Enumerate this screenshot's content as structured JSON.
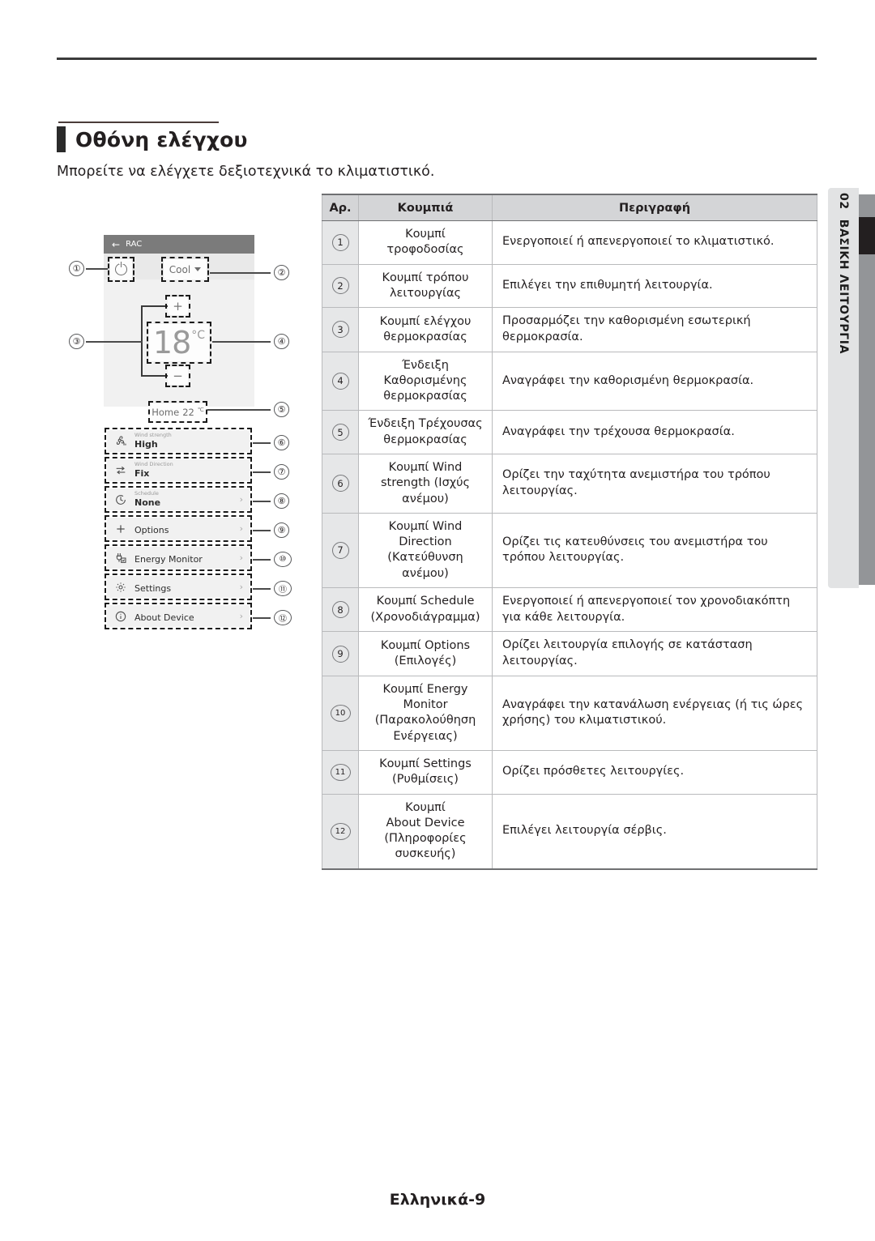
{
  "heading": {
    "title": "Οθόνη ελέγχου",
    "subtitle": "Μπορείτε να ελέγχετε δεξιοτεχνικά το κλιματιστικό."
  },
  "chapter_tab": {
    "number": "02",
    "label": "ΒΑΣΙΚΗ ΛΕΙΤΟΥΡΓΙΑ"
  },
  "device_mock": {
    "titlebar": {
      "back_icon": "←",
      "title": "RAC"
    },
    "power_button": "power-icon",
    "mode_button": {
      "label": "Cool",
      "caret": "▼"
    },
    "plus_button": "+",
    "minus_button": "−",
    "set_temp": {
      "value": "18",
      "unit": "°C"
    },
    "current_temp": {
      "label": "Home",
      "value": "22",
      "unit": "℃"
    },
    "rows": [
      {
        "icon": "fan-icon",
        "label": "Wind strength",
        "value": "High",
        "chevron": ""
      },
      {
        "icon": "arrows-icon",
        "label": "Wind Direction",
        "value": "Fix",
        "chevron": ""
      },
      {
        "icon": "clock-icon",
        "label": "Schedule",
        "value": "None",
        "chevron": "›"
      },
      {
        "icon": "plus-icon",
        "label": "",
        "value": "Options",
        "chevron": "›"
      },
      {
        "icon": "plug-icon",
        "label": "",
        "value": "Energy Monitor",
        "chevron": "›"
      },
      {
        "icon": "gear-icon",
        "label": "",
        "value": "Settings",
        "chevron": "›"
      },
      {
        "icon": "info-icon",
        "label": "",
        "value": "About Device",
        "chevron": "›"
      }
    ]
  },
  "callouts": {
    "left": [
      "①",
      "③"
    ],
    "right": [
      "②",
      "④",
      "⑤",
      "⑥",
      "⑦",
      "⑧",
      "⑨",
      "⑩",
      "⑪",
      "⑫"
    ]
  },
  "table": {
    "headers": [
      "Αρ.",
      "Κουμπιά",
      "Περιγραφή"
    ],
    "rows": [
      {
        "no": "1",
        "button": "Κουμπί\nτροφοδοσίας",
        "desc": "Ενεργοποιεί ή απενεργοποιεί το κλιματιστικό."
      },
      {
        "no": "2",
        "button": "Κουμπί τρόπου\nλειτουργίας",
        "desc": "Επιλέγει την επιθυμητή λειτουργία."
      },
      {
        "no": "3",
        "button": "Κουμπί ελέγχου\nθερμοκρασίας",
        "desc": "Προσαρμόζει την καθορισμένη εσωτερική θερμοκρασία."
      },
      {
        "no": "4",
        "button": "Ένδειξη\nΚαθορισμένης\nθερμοκρασίας",
        "desc": "Αναγράφει την καθορισμένη θερμοκρασία."
      },
      {
        "no": "5",
        "button": "Ένδειξη Τρέχουσας\nθερμοκρασίας",
        "desc": "Αναγράφει την τρέχουσα θερμοκρασία."
      },
      {
        "no": "6",
        "button": "Κουμπί Wind\nstrength (Ισχύς\nανέμου)",
        "desc": "Ορίζει την ταχύτητα ανεμιστήρα του τρόπου λειτουργίας."
      },
      {
        "no": "7",
        "button": "Κουμπί Wind\nDirection\n(Κατεύθυνση\nανέμου)",
        "desc": "Ορίζει τις κατευθύνσεις του ανεμιστήρα του τρόπου λειτουργίας."
      },
      {
        "no": "8",
        "button": "Κουμπί Schedule\n(Χρονοδιάγραμμα)",
        "desc": "Ενεργοποιεί ή απενεργοποιεί τον χρονοδιακόπτη για κάθε λειτουργία."
      },
      {
        "no": "9",
        "button": "Κουμπί Options\n(Επιλογές)",
        "desc": "Ορίζει λειτουργία επιλογής σε κατάσταση λειτουργίας."
      },
      {
        "no": "10",
        "button": "Κουμπί Energy\nMonitor\n(Παρακολούθηση\nΕνέργειας)",
        "desc": "Αναγράφει την κατανάλωση ενέργειας (ή τις ώρες χρήσης) του κλιματιστικού."
      },
      {
        "no": "11",
        "button": "Κουμπί Settings\n(Ρυθμίσεις)",
        "desc": "Ορίζει πρόσθετες λειτουργίες."
      },
      {
        "no": "12",
        "button": "Κουμπί\nAbout Device\n(Πληροφορίες\nσυσκευής)",
        "desc": "Επιλέγει λειτουργία σέρβις."
      }
    ]
  },
  "footer": {
    "page": "Ελληνικά-9"
  }
}
